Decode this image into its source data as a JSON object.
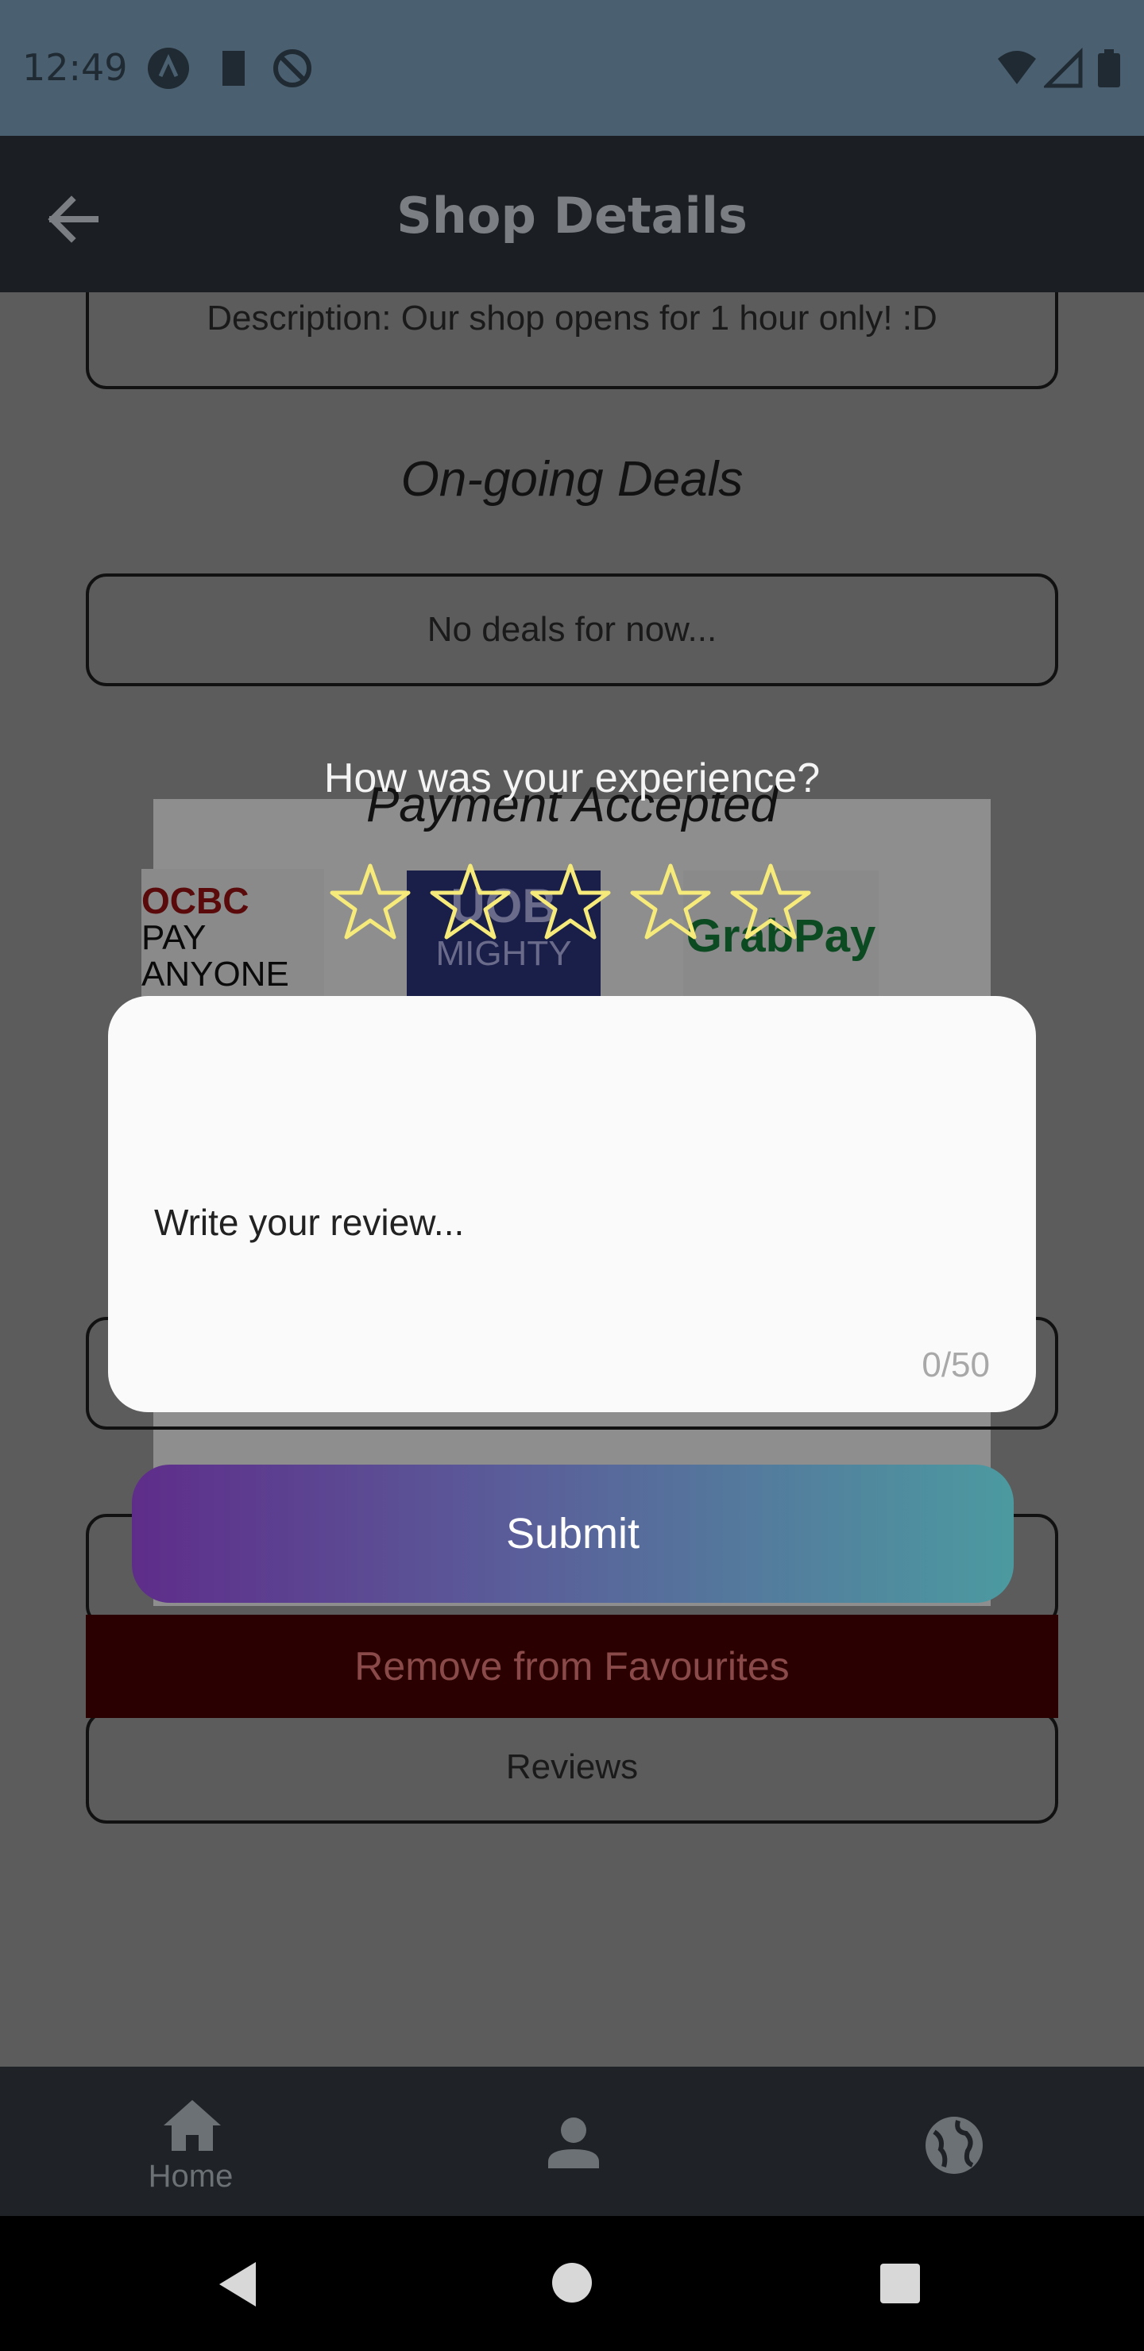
{
  "status_bar": {
    "time": "12:49",
    "icons_left": [
      "app-a-icon",
      "sd-card-icon",
      "no-sign-icon"
    ],
    "icons_right": [
      "wifi-icon",
      "signal-icon",
      "battery-icon"
    ]
  },
  "app_bar": {
    "title": "Shop Details",
    "back_icon": "arrow-left-icon"
  },
  "content": {
    "description": "Description: Our shop opens for 1 hour only! :D",
    "ongoing_deals_heading": "On-going Deals",
    "no_deals": "No deals for now...",
    "payment_heading": "Payment Accepted",
    "payment_logos": [
      {
        "line1": "OCBC",
        "line2": "PAY",
        "line3": "ANYONE"
      },
      {
        "line1": "UOB",
        "line2": "MIGHTY"
      },
      {
        "line1": "GrabPay"
      }
    ],
    "reviews_label": "Reviews",
    "remove_favourites_label": "Remove from Favourites"
  },
  "dialog": {
    "title": "How was your experience?",
    "rating": {
      "value": 0,
      "max": 5
    },
    "review_placeholder": "Write your review...",
    "char_count": "0/50",
    "submit_label": "Submit"
  },
  "bottom_nav": {
    "items": [
      {
        "label": "Home",
        "icon": "home-icon"
      },
      {
        "label": "",
        "icon": "person-icon"
      },
      {
        "label": "",
        "icon": "globe-icon"
      }
    ]
  },
  "colors": {
    "star_outline": "#f5ea7a",
    "submit_gradient_start": "#5e2d8a",
    "submit_gradient_end": "#4c9aa0",
    "remove_button": "#2a0000"
  }
}
